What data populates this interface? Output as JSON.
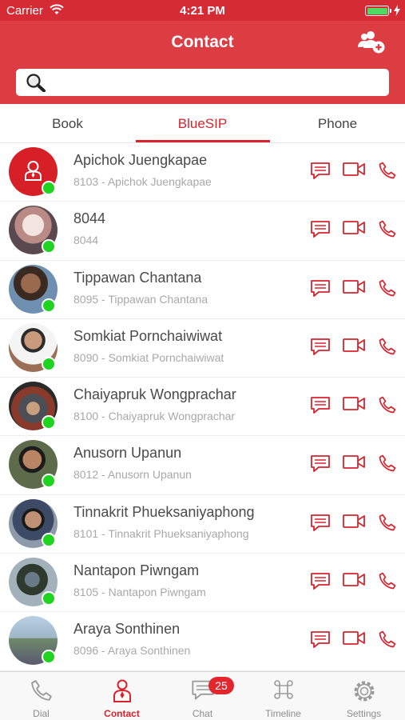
{
  "status_bar": {
    "carrier": "Carrier",
    "time": "4:21 PM",
    "battery_level": 1.0
  },
  "header": {
    "title": "Contact",
    "add_contact_icon": "add-user-icon"
  },
  "search": {
    "placeholder": "",
    "value": ""
  },
  "tabs": [
    {
      "label": "Book",
      "active": false
    },
    {
      "label": "BlueSIP",
      "active": true
    },
    {
      "label": "Phone",
      "active": false
    }
  ],
  "contacts": [
    {
      "name": "Apichok Juengkapae",
      "subtitle": "8103 - Apichok Juengkapae",
      "online": true
    },
    {
      "name": "8044",
      "subtitle": "8044",
      "online": true
    },
    {
      "name": "Tippawan Chantana",
      "subtitle": "8095 - Tippawan Chantana",
      "online": true
    },
    {
      "name": "Somkiat Pornchaiwiwat",
      "subtitle": "8090 - Somkiat Pornchaiwiwat",
      "online": true
    },
    {
      "name": "Chaiyapruk Wongprachar",
      "subtitle": "8100 - Chaiyapruk Wongprachar",
      "online": true
    },
    {
      "name": "Anusorn Upanun",
      "subtitle": "8012 - Anusorn Upanun",
      "online": true
    },
    {
      "name": "Tinnakrit Phueksaniyaphong",
      "subtitle": "8101 - Tinnakrit Phueksaniyaphong",
      "online": true
    },
    {
      "name": "Nantapon Piwngam",
      "subtitle": "8105 - Nantapon Piwngam",
      "online": true
    },
    {
      "name": "Araya Sonthinen",
      "subtitle": "8096 - Araya Sonthinen",
      "online": true
    }
  ],
  "tab_bar": {
    "items": [
      {
        "label": "Dial",
        "icon": "phone-icon",
        "active": false
      },
      {
        "label": "Contact",
        "icon": "person-icon",
        "active": true
      },
      {
        "label": "Chat",
        "icon": "chat-icon",
        "active": false,
        "badge": "25"
      },
      {
        "label": "Timeline",
        "icon": "command-icon",
        "active": false
      },
      {
        "label": "Settings",
        "icon": "gear-icon",
        "active": false
      }
    ]
  },
  "colors": {
    "primary": "#dc3d43",
    "accent": "#d8232e",
    "online": "#21d321"
  }
}
